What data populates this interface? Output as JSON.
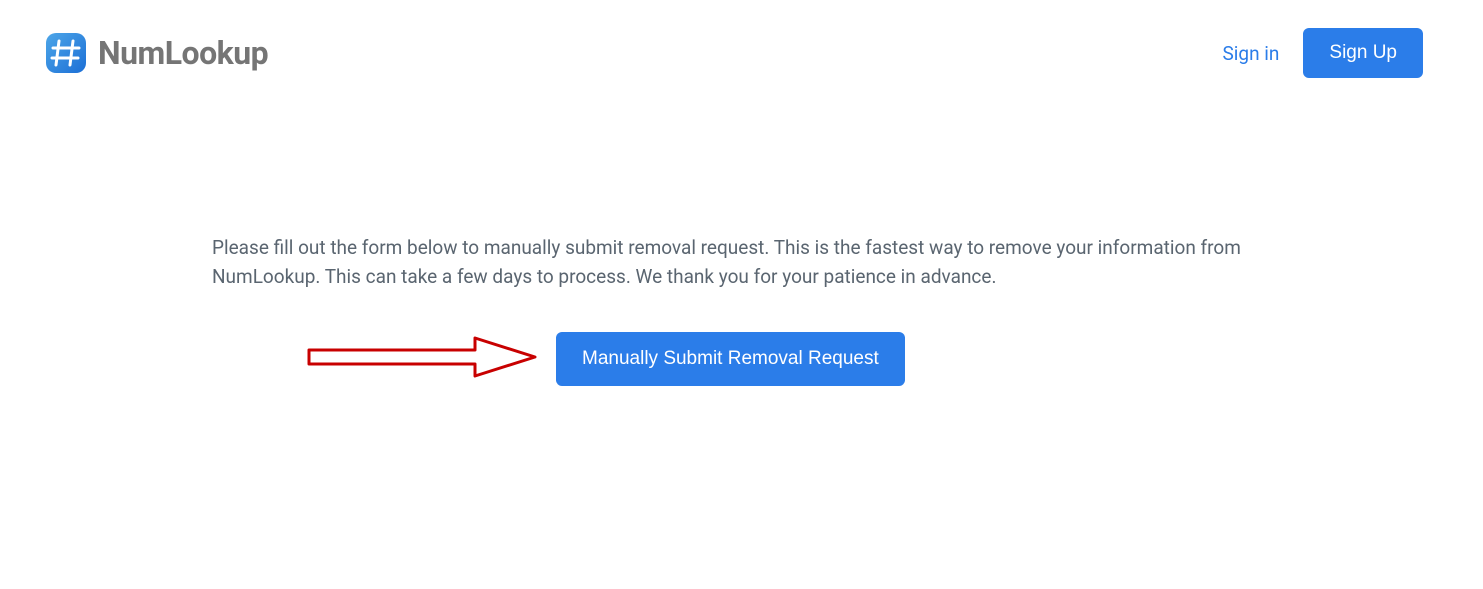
{
  "header": {
    "logo_text": "NumLookup",
    "signin_label": "Sign in",
    "signup_label": "Sign Up"
  },
  "main": {
    "instruction": "Please fill out the form below to manually submit removal request. This is the fastest way to remove your information from NumLookup. This can take a few days to process. We thank you for your patience in advance.",
    "submit_label": "Manually Submit Removal Request"
  },
  "annotation": {
    "arrow_color": "#c80000"
  }
}
